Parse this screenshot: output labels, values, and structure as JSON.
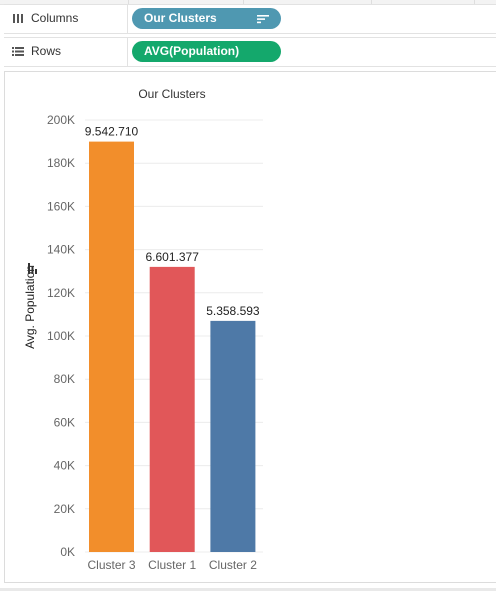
{
  "shelves": {
    "columns": {
      "label": "Columns",
      "pill": "Our Clusters",
      "pill_color": "#4f98b1"
    },
    "rows": {
      "label": "Rows",
      "pill": "AVG(Population)",
      "pill_color": "#14a86c"
    }
  },
  "chart_data": {
    "type": "bar",
    "title": "Our Clusters",
    "xlabel": "",
    "ylabel": "Avg. Population",
    "categories": [
      "Cluster 3",
      "Cluster 1",
      "Cluster 2"
    ],
    "values": [
      190000,
      132000,
      107000
    ],
    "data_labels": [
      "9.542.710",
      "6.601.377",
      "5.358.593"
    ],
    "colors": [
      "#f28e2b",
      "#e15759",
      "#4e79a7"
    ],
    "ylim": [
      0,
      200000
    ],
    "yticks": [
      0,
      20000,
      40000,
      60000,
      80000,
      100000,
      120000,
      140000,
      160000,
      180000,
      200000
    ],
    "ytick_labels": [
      "0K",
      "20K",
      "40K",
      "60K",
      "80K",
      "100K",
      "120K",
      "140K",
      "160K",
      "180K",
      "200K"
    ],
    "grid": true
  }
}
